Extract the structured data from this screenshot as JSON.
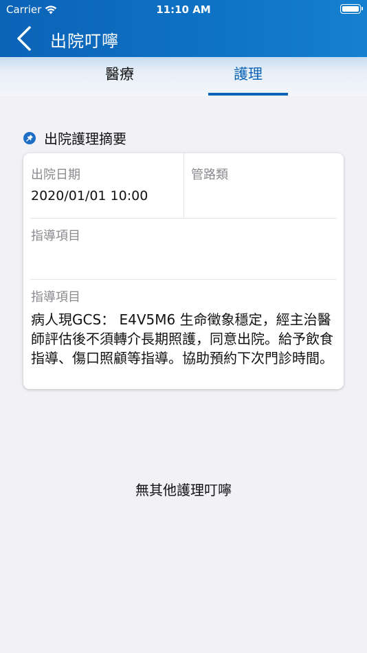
{
  "status_bar": {
    "carrier": "Carrier",
    "time": "11:10 AM"
  },
  "nav": {
    "title": "出院叮嚀"
  },
  "tabs": [
    {
      "label": "醫療",
      "selected": false
    },
    {
      "label": "護理",
      "selected": true
    }
  ],
  "section": {
    "title": "出院護理摘要"
  },
  "card": {
    "discharge_date_label": "出院日期",
    "discharge_date_value": "2020/01/01 10:00",
    "tube_label": "管路類",
    "tube_value": "",
    "guidance_label_1": "指導項目",
    "guidance_value_1": "",
    "guidance_label_2": "指導項目",
    "guidance_value_2": "病人現GCS： E4V5M6 生命徵象穩定，經主治醫師評估後不須轉介長期照護，同意出院。給予飲食指導、傷口照顧等指導。協助預約下次門診時間。"
  },
  "empty_message": "無其他護理叮嚀",
  "colors": {
    "primary": "#0b63b6",
    "background": "#f1f1f6"
  },
  "icons": [
    "wifi-icon",
    "battery-icon",
    "back-chevron-icon",
    "pin-icon"
  ]
}
